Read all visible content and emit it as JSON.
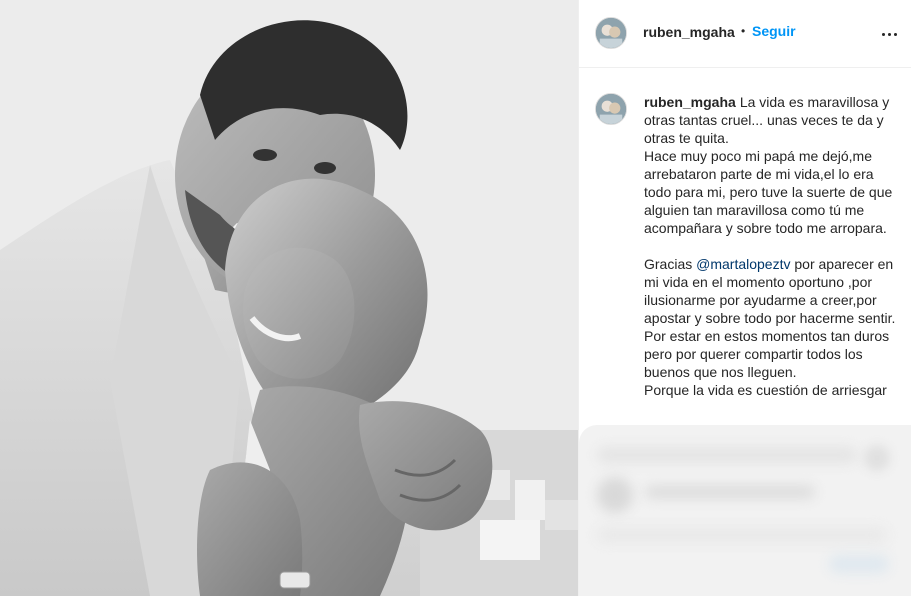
{
  "post": {
    "photo_alt": "Black and white photo of a couple embracing",
    "image_style": "monochrome"
  },
  "header": {
    "username": "ruben_mgaha",
    "separator": "•",
    "follow_label": "Seguir",
    "more_icon": "more-horizontal-icon"
  },
  "caption": {
    "username": "ruben_mgaha",
    "paragraph1_text": "La vida es maravillosa y otras tantas cruel... unas veces te da y otras te quita.",
    "paragraph2": "Hace muy poco mi papá me dejó,me arrebataron parte de mi vida,el lo era todo para mi, pero tuve la suerte de que alguien tan maravillosa como tú me acompañara y sobre todo me arropara.",
    "paragraph3_before": "Gracias ",
    "mention": "@martalopeztv",
    "paragraph3_after": " por aparecer en mi vida en el momento oportuno ,por ilusionarme por ayudarme a creer,por apostar y sobre todo por hacerme sentir.",
    "paragraph4": "Por estar en estos momentos tan duros pero por querer compartir todos los buenos que nos lleguen.",
    "paragraph5": "Porque la vida es cuestión de arriesgar"
  },
  "colors": {
    "link": "#0095f6",
    "mention": "#00376b",
    "text": "#262626",
    "border": "#efefef"
  }
}
